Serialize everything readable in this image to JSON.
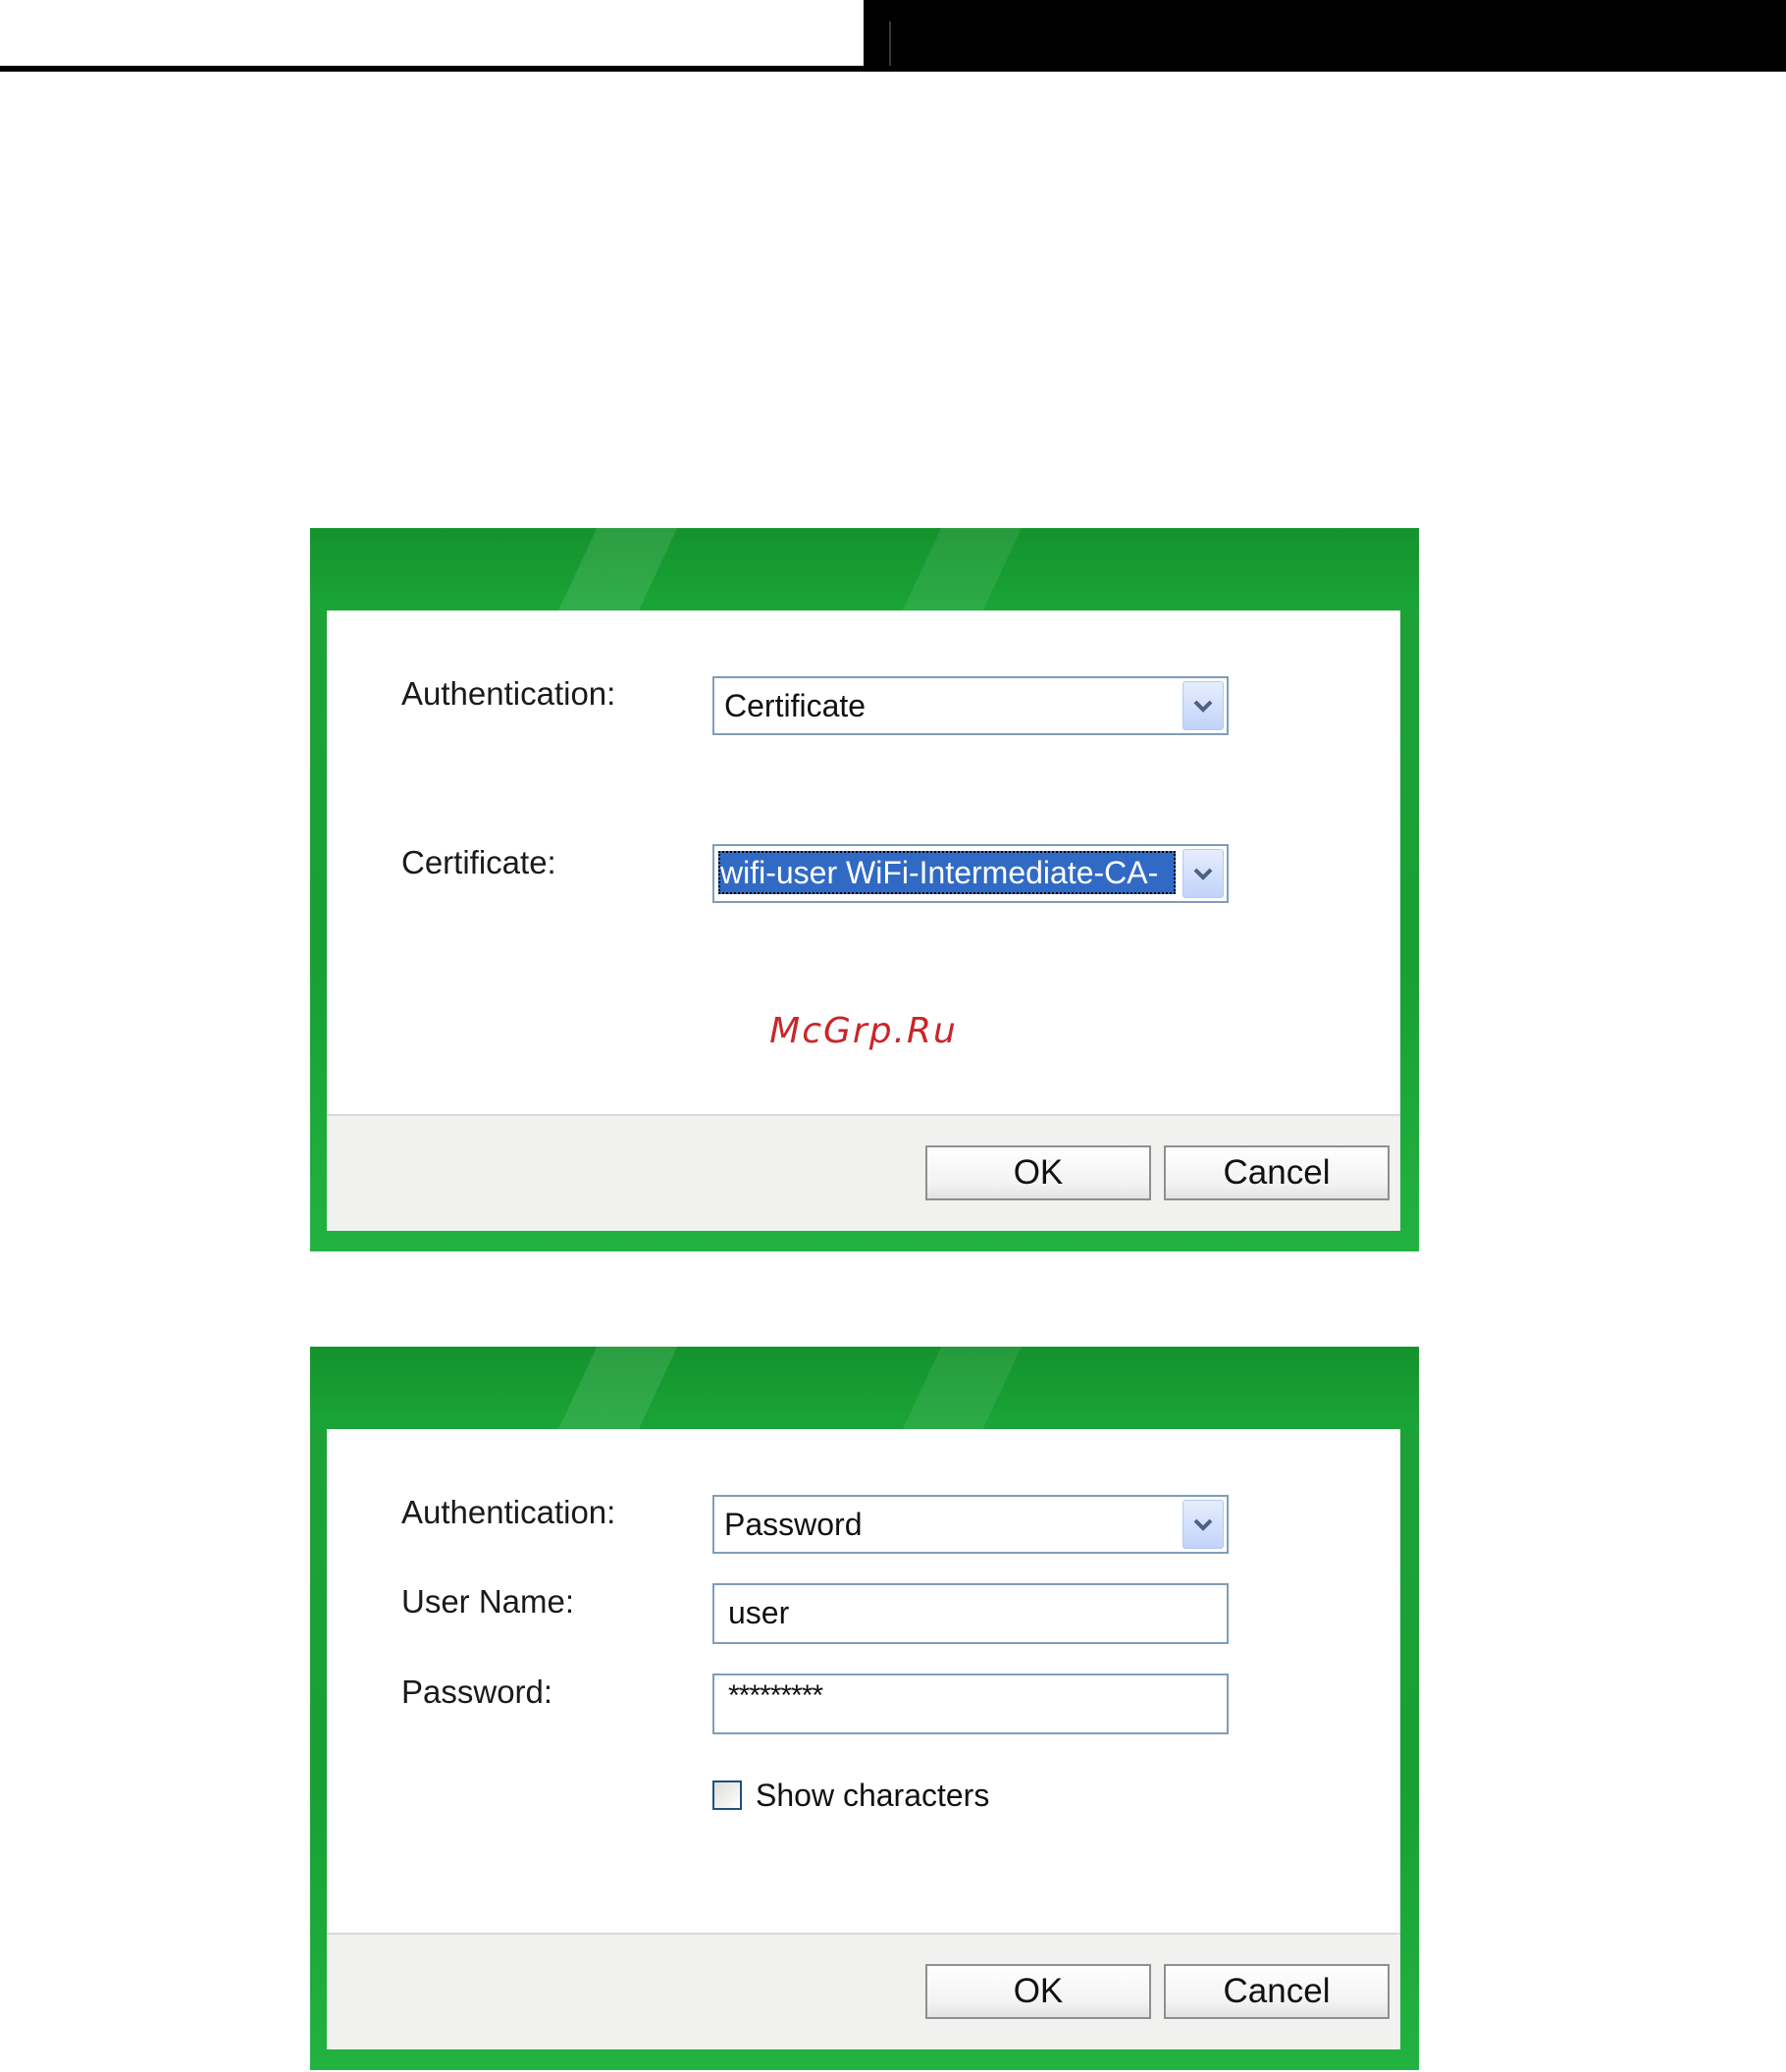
{
  "dialog_certificate": {
    "authentication_label": "Authentication:",
    "authentication_value": "Certificate",
    "certificate_label": "Certificate:",
    "certificate_value": "wifi-user WiFi-Intermediate-CA-",
    "watermark": "McGrp.Ru",
    "ok_label": "OK",
    "cancel_label": "Cancel"
  },
  "dialog_password": {
    "authentication_label": "Authentication:",
    "authentication_value": "Password",
    "username_label": "User Name:",
    "username_value": "user",
    "password_label": "Password:",
    "password_value": "*********",
    "show_characters_label": "Show characters",
    "show_characters_checked": false,
    "ok_label": "OK",
    "cancel_label": "Cancel"
  },
  "icons": {
    "dropdown": "chevron-down-icon"
  },
  "colors": {
    "dialog_green": "#1aa537",
    "selection_blue": "#316ac5",
    "watermark_red": "#c8262b"
  }
}
